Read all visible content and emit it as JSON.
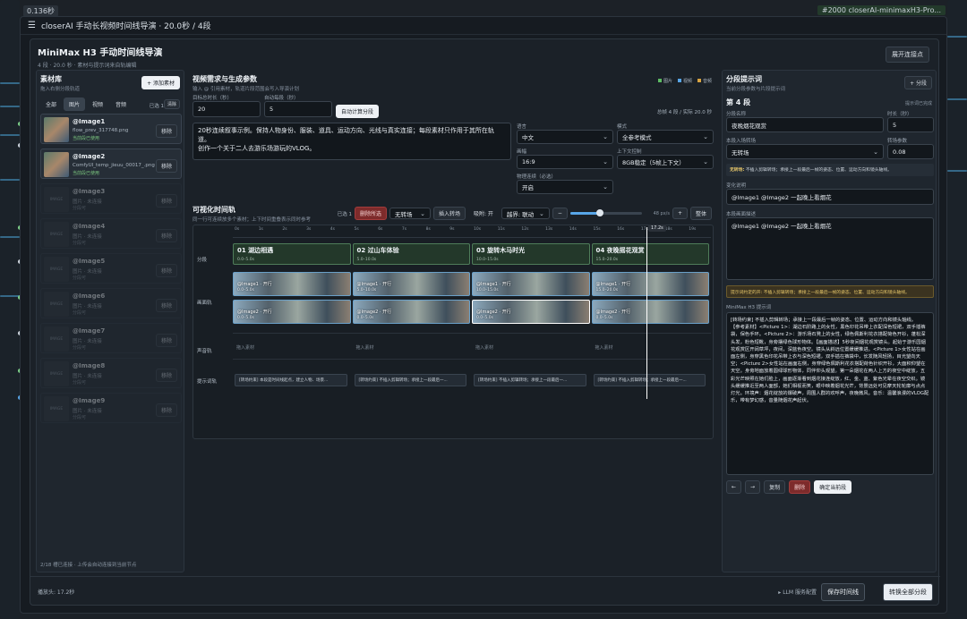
{
  "top": {
    "left_badge": "0.136秒",
    "right_badge": "#2000 closerAI-minimaxH3-Pro..."
  },
  "window": {
    "title": "closerAI 手动长视频时间线导演 · 20.0秒 / 4段"
  },
  "header": {
    "title": "MiniMax H3 手动时间线导演",
    "subtitle": "4 段 · 20.0 秒 · 素材与提示词来自轨编辑",
    "expand_button": "展开连接点"
  },
  "library": {
    "title": "素材库",
    "subtitle": "拖入右侧分段轨道",
    "add_button": "+ 添加素材",
    "tabs": [
      "全部",
      "图片",
      "视频",
      "音频"
    ],
    "active_tab": 1,
    "selected_count": "已选 1",
    "clear_button": "清除",
    "remove_label": "移除",
    "assets": [
      {
        "name": "@Image1",
        "file": "flow_prev_317748.png",
        "status": "当前段已使用",
        "active": true
      },
      {
        "name": "@Image2",
        "file": "ComfyUI_temp_jieuu_00017_.png",
        "status": "当前段已使用",
        "active": true
      },
      {
        "name": "@Image3",
        "file": "图片 · 未连接",
        "status": "分段可",
        "active": false
      },
      {
        "name": "@Image4",
        "file": "图片 · 未连接",
        "status": "分段可",
        "active": false
      },
      {
        "name": "@Image5",
        "file": "图片 · 未连接",
        "status": "分段可",
        "active": false
      },
      {
        "name": "@Image6",
        "file": "图片 · 未连接",
        "status": "分段可",
        "active": false
      },
      {
        "name": "@Image7",
        "file": "图片 · 未连接",
        "status": "分段可",
        "active": false
      },
      {
        "name": "@Image8",
        "file": "图片 · 未连接",
        "status": "分段可",
        "active": false
      },
      {
        "name": "@Image9",
        "file": "图片 · 未连接",
        "status": "分段可",
        "active": false
      }
    ],
    "thumb_placeholder": "IMAGE",
    "footer": "2/18 槽已连接 · 上传会自动连接到当前节点"
  },
  "request": {
    "title": "视频需求与生成参数",
    "subtitle": "输入 @ 引用素材，轨道片段范围会写入导演计划",
    "legend": [
      "图片",
      "视频",
      "音频"
    ],
    "legend_colors": [
      "#5dbb63",
      "#58a6e8",
      "#d9a441"
    ],
    "target_label": "目标总时长（秒）",
    "target_value": "20",
    "auto_label": "自动每段（秒）",
    "auto_value": "5",
    "auto_button": "自动计算分段",
    "summary": "总帧 4 段 / 实际 20.0 秒",
    "prompt_line1": "20秒连续叙事示例。保持人物身份、服装、道具、运动方向、光线与真实连接；每段素材只作用于其所在轨道。",
    "prompt_line2": "创作一个关于二人去游乐场游玩的VLOG。",
    "language_label": "语言",
    "language_value": "中文",
    "mode_label": "模式",
    "mode_value": "全参考模式",
    "ratio_label": "画幅",
    "ratio_value": "16:9",
    "context_label": "上下文控制",
    "context_value": "8GB稳定（5帧上下文）",
    "physics_label": "物理连续（必选）",
    "physics_value": "开启"
  },
  "timeline": {
    "title": "可视化时间轨",
    "subtitle": "同一行可连续放多个素材；上下时间重叠表示同时参考",
    "selected": "已选 1",
    "delete_selected": "删除所选",
    "transition_value": "无转场",
    "insert_transition": "插入转场",
    "snap": "吸附: 开",
    "span_value": "越界: 联动",
    "zoom_minus": "−",
    "zoom_plus": "+",
    "zoom_value": "48 px/s",
    "fit_button": "整体",
    "playhead": "17.2s",
    "playhead_fraction": 0.86,
    "ticks": [
      "0s",
      "1s",
      "2s",
      "3s",
      "4s",
      "5s",
      "6s",
      "7s",
      "8s",
      "9s",
      "10s",
      "11s",
      "12s",
      "13s",
      "14s",
      "15s",
      "16s",
      "17s",
      "18s",
      "19s"
    ],
    "row_labels": [
      "分段",
      "画面轨",
      "声音轨",
      "提示词轨"
    ],
    "segments": [
      {
        "title": "01 湖边相遇",
        "range": "0.0–5.0s"
      },
      {
        "title": "02 过山车体验",
        "range": "5.0–10.0s"
      },
      {
        "title": "03 旋转木马时光",
        "range": "10.0–15.0s"
      },
      {
        "title": "04 夜晚摇花观赏",
        "range": "15.0–20.0s"
      }
    ],
    "clips_top": [
      {
        "label": "@Image1 · 开行",
        "range": "0.0–5.0s"
      },
      {
        "label": "@Image1 · 开行",
        "range": "5.0–10.0s"
      },
      {
        "label": "@Image1 · 开行",
        "range": "10.0–15.0s"
      },
      {
        "label": "@Image1 · 开行",
        "range": "15.0–20.0s"
      }
    ],
    "clips_bottom": [
      {
        "label": "@Image2 · 开行",
        "range": "0.0–5.0s"
      },
      {
        "label": "@Image2 · 开行",
        "range": "0.0–5.0s"
      },
      {
        "label": "@Image2 · 开行",
        "range": "0.0–5.0s"
      },
      {
        "label": "@Image2 · 开行",
        "range": "0.0–5.0s"
      }
    ],
    "audio_hint": "拖入素材",
    "prompts": [
      "[转场约束] 本段是时间线起点，建立人物、场景...",
      "[转场约束] 不插入剪辑转场；承接上一段最后一...",
      "[转场约束] 不插入剪辑转场；承接上一段最后一...",
      "[转场约束] 不插入剪辑转场；承接上一段最后一..."
    ],
    "footer": "播放头: 17.2秒"
  },
  "segment_prompt": {
    "title": "分段提示词",
    "subtitle": "当前分段参数与片段提示词",
    "add_button": "+ 分段",
    "segment_title": "第 4 段",
    "hint": "提示词已完成",
    "name_label": "分段名称",
    "name_value": "夜晚烟花观赏",
    "duration_label": "时长（秒）",
    "duration_value": "5",
    "transition_label": "本段入场转场",
    "transition_value": "无转场",
    "strength_label": "转场参数",
    "strength_value": "0.08",
    "transition_note_key": "无转场:",
    "transition_note": "不插入剪辑转场；承接上一段最后一帧的姿态、位置、运动方向和镜头轴线。",
    "summary_label": "变化说明",
    "summary_value": "@Image1 @Image2 一起晚上看烟花",
    "desc_label": "本段画面描述",
    "desc_value": "@Image1 @Image2 一起晚上看烟花",
    "warning": "提示词约定的开: 不插入剪辑转场；承接上一段最后一帧的姿态、位置、运动方向和镜头轴线。",
    "h3_label": "MiniMax H3 提示词",
    "h3_text_1": "[转场约束] 不插入剪辑转场；承接上一段最后一帧的姿态、位置、运动方向和镜头轴线。",
    "h3_text_2": "【参考素材】<Picture 1>：湖边石阶路上的女性，黑色印花吊带上衣配深色短裙，双手插裤袋，保色手环。<Picture 2>：游乐场石凳上的女性，绿色佩斯利花衣搭配荷色开衫，蓬松深头发，粉色短靴，身旁摆绿色球形物体。【画面描述】5秒夜间烟花观赏镜头。起始于游乐园烟花观赏区开阔草坪，夜间，深蓝色夜空。镜头从斜远位置缓缓推进。<Picture 1>女性站在画面左侧，身穿黑色印花吊带上衣与深色短裙，双手插在裤袋中，长发随风轻扬，目光望向天空；<Picture 2>女性站在画面右侧，身穿绿色佩斯利花衣搭配荷色针织开衫，大面积仰望在天空。身旁地面放着圆绿球形物体，同伴仰头观望。第一朵烟花在两人上方的夜空中绽放，五彩光芒映照在她们脸上，画面逐渐看到烟花接连绽放，红、金、蓝、紫色光晕在夜空交织。镜头缓缓推近至两人面部，她们相视而笑，眼中映着烟花光芒，背景远处可见摩天轮轮廓与点点灯光。环境声：烟花绽放的爆破声，周围人群的欢呼声，夜晚微风。音乐：温馨浪漫的VLOG配乐，带有梦幻感，音量随烟花声起伏。",
    "prev": "←",
    "next": "→",
    "copy_button": "复制",
    "delete_button": "删除",
    "confirm_button": "确定当前段",
    "llm_link": "▸ LLM 服务配置",
    "save_button": "保存时间线",
    "convert_button": "转换全部分段"
  }
}
